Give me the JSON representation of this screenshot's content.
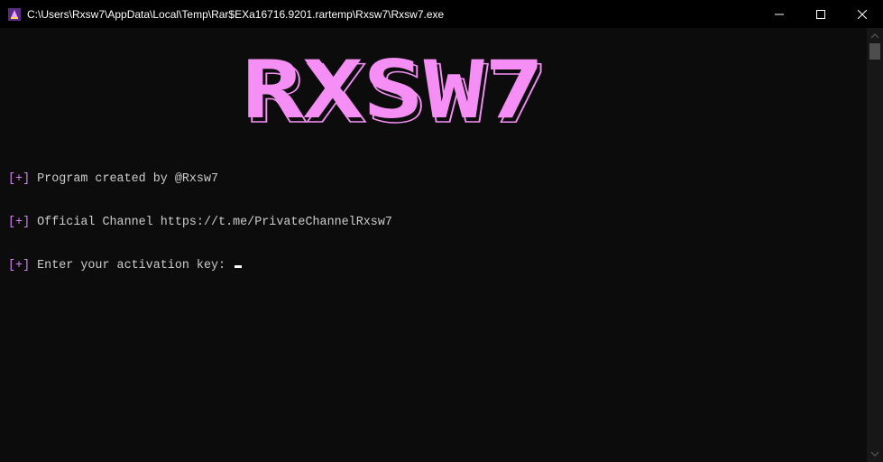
{
  "window": {
    "title": "C:\\Users\\Rxsw7\\AppData\\Local\\Temp\\Rar$EXa16716.9201.rartemp\\Rxsw7\\Rxsw7.exe",
    "controls": {
      "minimize_icon": "minimize-icon",
      "maximize_icon": "maximize-icon",
      "close_icon": "close-icon"
    }
  },
  "console": {
    "logo_text": "RXSW7",
    "lines": [
      {
        "prefix": "[+]",
        "text": " Program created by @Rxsw7"
      },
      {
        "prefix": "[+]",
        "text": " Official Channel https://t.me/PrivateChannelRxsw7"
      },
      {
        "prefix": "[+]",
        "text": " Enter your activation key: "
      }
    ]
  },
  "colors": {
    "background": "#0c0c0c",
    "titlebar": "#000000",
    "text": "#cccccc",
    "accent_pink": "#f58ff5",
    "prefix": "#d67ff0"
  }
}
